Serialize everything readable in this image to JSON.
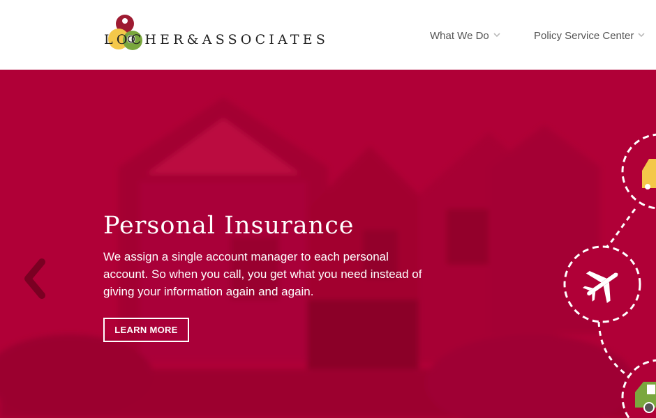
{
  "brand": {
    "logo_text": "LOCHER&ASSOCIATES"
  },
  "nav": {
    "items": [
      {
        "label": "What We Do"
      },
      {
        "label": "Policy Service Center"
      }
    ]
  },
  "hero": {
    "title": "Personal Insurance",
    "description": "We assign a single account manager to each personal account. So when you call, you get what you need instead of giving your information again and again.",
    "cta_label": "LEARN MORE"
  },
  "icons": [
    "car-icon",
    "plane-icon",
    "rv-icon",
    "chevron-left-icon",
    "chevron-down-icon"
  ],
  "colors": {
    "hero_bg": "#b00037",
    "nav_text": "#555555",
    "logo_red": "#9e1b32",
    "logo_yellow": "#f4c84a",
    "logo_green": "#7aa73e"
  }
}
